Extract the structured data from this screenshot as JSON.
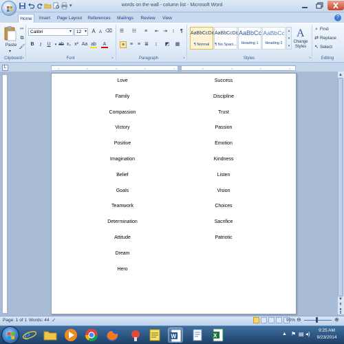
{
  "window": {
    "title": "words on the wall - column list - Microsoft Word"
  },
  "tabs": [
    "Home",
    "Insert",
    "Page Layout",
    "References",
    "Mailings",
    "Review",
    "View"
  ],
  "ribbon": {
    "clipboard": {
      "paste_label": "Paste",
      "group_label": "Clipboard"
    },
    "font": {
      "font_name": "Calibri",
      "font_size": "12",
      "group_label": "Font"
    },
    "paragraph": {
      "group_label": "Paragraph"
    },
    "styles": {
      "items": [
        {
          "sample": "AaBbCcDc",
          "name": "¶ Normal"
        },
        {
          "sample": "AaBbCcDc",
          "name": "¶ No Spaci..."
        },
        {
          "sample": "AaBbCc",
          "name": "Heading 1"
        },
        {
          "sample": "AaBbCc",
          "name": "Heading 2"
        }
      ],
      "change_styles_label": "Change Styles",
      "group_label": "Styles"
    },
    "editing": {
      "find_label": "Find",
      "replace_label": "Replace",
      "select_label": "Select",
      "group_label": "Editing"
    }
  },
  "document": {
    "column_left": [
      "Love",
      "Family",
      "Compassion",
      "Victory",
      "Positive",
      "Imagination",
      "Belief",
      "Goals",
      "Teamwork",
      "Determination",
      "Attitude",
      "Dream",
      "Hero"
    ],
    "column_right": [
      "Success",
      "Discipline",
      "Trust",
      "Passion",
      "Emotion",
      "Kindness",
      "Listen",
      "Vision",
      "Choices",
      "Sacrifice",
      "Patriotic"
    ]
  },
  "status": {
    "page": "Page: 1 of 1",
    "words": "Words: 44",
    "zoom": "90%"
  },
  "clock": {
    "time": "9:25 AM",
    "date": "9/23/2014"
  },
  "colors": {
    "ribbon_bg": "#dfe9f5",
    "accent": "#15428b",
    "taskbar": "#1d3f66"
  }
}
